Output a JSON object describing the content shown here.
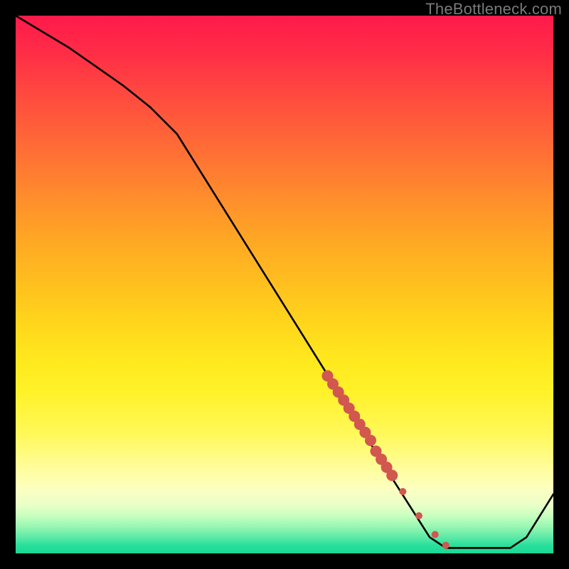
{
  "attribution": "TheBottleneck.com",
  "chart_data": {
    "type": "line",
    "title": "",
    "xlabel": "",
    "ylabel": "",
    "xlim": [
      0,
      100
    ],
    "ylim": [
      0,
      100
    ],
    "background_gradient": {
      "top": "#ff1a4a",
      "bottom": "#18d996"
    },
    "series": [
      {
        "name": "bottleneck-curve",
        "kind": "line",
        "color": "#000000",
        "x": [
          0,
          10,
          20,
          25,
          30,
          40,
          50,
          60,
          70,
          77,
          80,
          86,
          92,
          95,
          100
        ],
        "y": [
          100,
          94,
          87,
          83,
          78,
          62,
          46,
          30,
          14,
          3,
          1,
          1,
          1,
          3,
          11
        ]
      },
      {
        "name": "highlight-segment",
        "kind": "scatter",
        "color": "#d1574f",
        "note": "elongated cluster of points overlaid on the descending curve between x≈58 and x≈80; densest between 58-70, sparser isolated points near 72, 75, 78, 80",
        "x": [
          58,
          59,
          60,
          61,
          62,
          63,
          64,
          65,
          66,
          67,
          68,
          69,
          70,
          72,
          75,
          78,
          80
        ],
        "y": [
          33,
          31.5,
          30,
          28.5,
          27,
          25.5,
          24,
          22.5,
          21,
          19,
          17.5,
          16,
          14.5,
          11.5,
          7,
          3.5,
          1.5
        ]
      }
    ]
  }
}
